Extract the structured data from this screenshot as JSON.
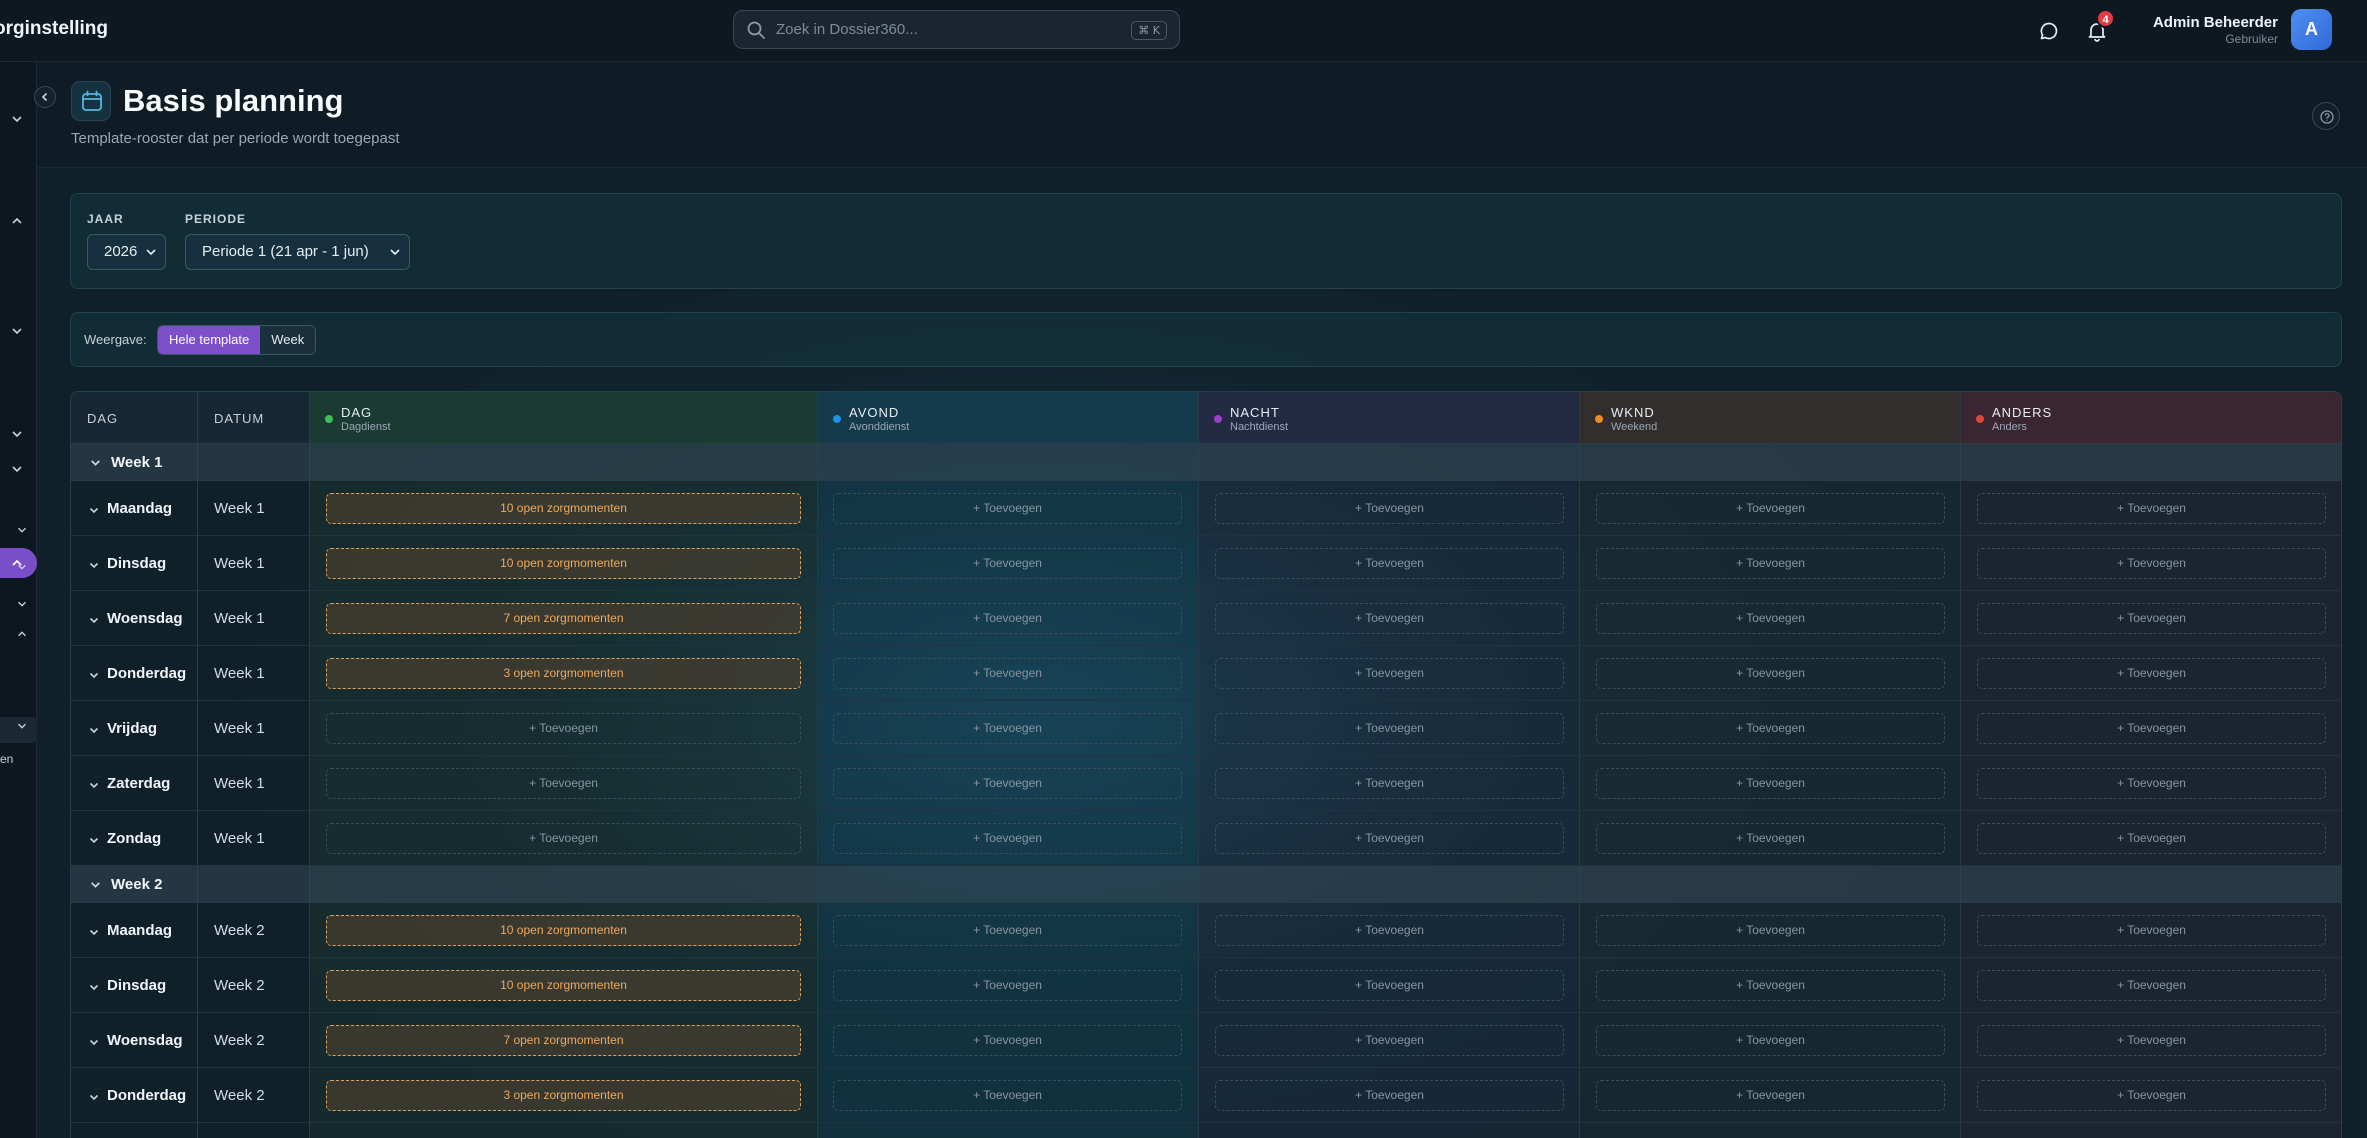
{
  "header": {
    "app_title": "orginstelling",
    "search_placeholder": "Zoek in Dossier360...",
    "search_shortcut": "⌘ K",
    "notification_count": "4",
    "user_name": "Admin Beheerder",
    "user_role": "Gebruiker",
    "avatar_initial": "A"
  },
  "sidebar": {
    "partial_label": "en"
  },
  "page": {
    "title": "Basis planning",
    "subtitle": "Template-rooster dat per periode wordt toegepast"
  },
  "filters": {
    "year_label": "JAAR",
    "year_value": "2026",
    "period_label": "PERIODE",
    "period_value": "Periode 1 (21 apr - 1 jun)"
  },
  "view": {
    "label": "Weergave:",
    "options": [
      "Hele template",
      "Week"
    ],
    "selected": "Hele template"
  },
  "table": {
    "columns": {
      "day": "DAG",
      "date": "DATUM"
    },
    "shifts": [
      {
        "title": "DAG",
        "subtitle": "Dagdienst",
        "color": "#3fbf5a"
      },
      {
        "title": "AVOND",
        "subtitle": "Avonddienst",
        "color": "#1e90e8"
      },
      {
        "title": "NACHT",
        "subtitle": "Nachtdienst",
        "color": "#9b3fc8"
      },
      {
        "title": "WKND",
        "subtitle": "Weekend",
        "color": "#f08a24"
      },
      {
        "title": "ANDERS",
        "subtitle": "Anders",
        "color": "#e2453d"
      }
    ],
    "add_label": "+ Toevoegen",
    "weeks": [
      {
        "label": "Week 1",
        "rows": [
          {
            "day": "Maandag",
            "week": "Week 1",
            "dag": "10 open zorgmomenten"
          },
          {
            "day": "Dinsdag",
            "week": "Week 1",
            "dag": "10 open zorgmomenten"
          },
          {
            "day": "Woensdag",
            "week": "Week 1",
            "dag": "7 open zorgmomenten"
          },
          {
            "day": "Donderdag",
            "week": "Week 1",
            "dag": "3 open zorgmomenten"
          },
          {
            "day": "Vrijdag",
            "week": "Week 1",
            "dag": ""
          },
          {
            "day": "Zaterdag",
            "week": "Week 1",
            "dag": ""
          },
          {
            "day": "Zondag",
            "week": "Week 1",
            "dag": ""
          }
        ]
      },
      {
        "label": "Week 2",
        "rows": [
          {
            "day": "Maandag",
            "week": "Week 2",
            "dag": "10 open zorgmomenten"
          },
          {
            "day": "Dinsdag",
            "week": "Week 2",
            "dag": "10 open zorgmomenten"
          },
          {
            "day": "Woensdag",
            "week": "Week 2",
            "dag": "7 open zorgmomenten"
          },
          {
            "day": "Donderdag",
            "week": "Week 2",
            "dag": "3 open zorgmomenten"
          }
        ]
      }
    ]
  }
}
